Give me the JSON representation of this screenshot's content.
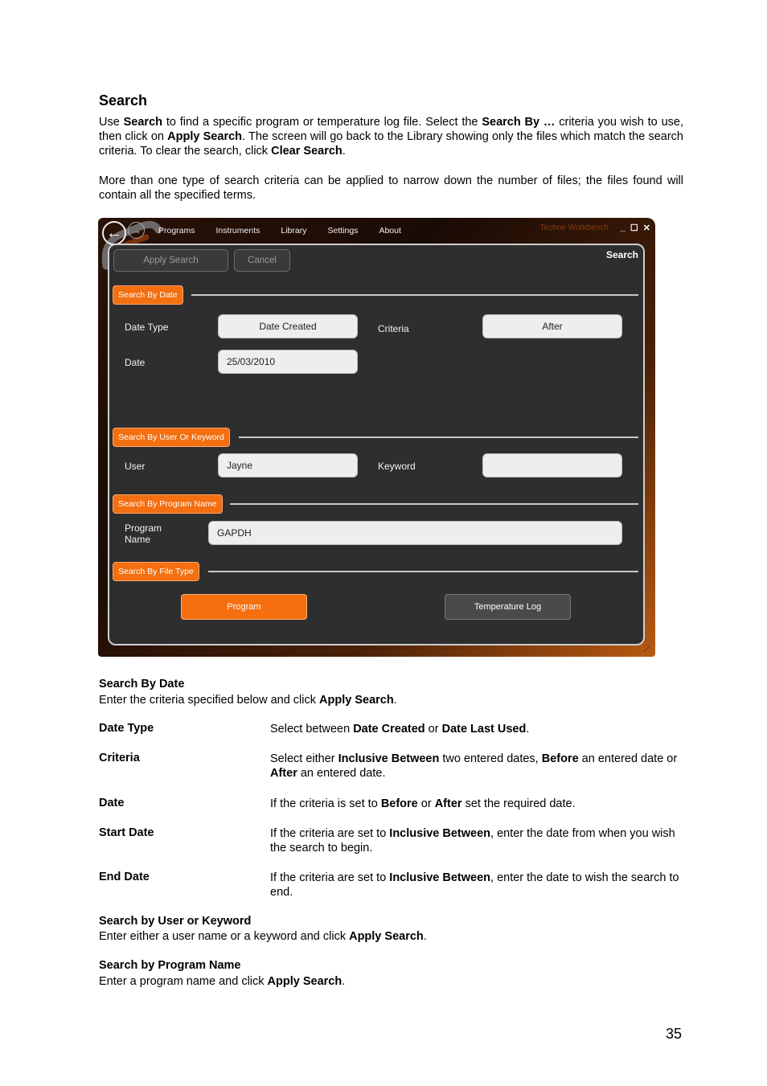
{
  "doc": {
    "title": "Search",
    "intro_parts": [
      {
        "t": "Use ",
        "b": false
      },
      {
        "t": "Search",
        "b": true
      },
      {
        "t": " to find a specific program or temperature log file. Select the ",
        "b": false
      },
      {
        "t": "Search By …",
        "b": true
      },
      {
        "t": " criteria you wish to use, then click on ",
        "b": false
      },
      {
        "t": "Apply Search",
        "b": true
      },
      {
        "t": ". The screen will go back to the Library showing only the files which match the search criteria. To clear the search, click ",
        "b": false
      },
      {
        "t": "Clear Search",
        "b": true
      },
      {
        "t": ".",
        "b": false
      }
    ],
    "para2": "More than one type of search criteria can be applied to narrow down the number of files; the files found will contain all the specified terms.",
    "page_number": "35"
  },
  "app": {
    "menu": [
      "Programs",
      "Instruments",
      "Library",
      "Settings",
      "About"
    ],
    "app_name": "Techne Workbench",
    "window_controls": {
      "minimize": "_",
      "maximize": "☐",
      "close": "✕"
    },
    "apply_search": "Apply Search",
    "cancel": "Cancel",
    "panel_title": "Search",
    "sections": {
      "date": "Search By Date",
      "user": "Search By User Or Keyword",
      "program": "Search By Program Name",
      "filetype": "Search By File Type"
    },
    "labels": {
      "date_type": "Date Type",
      "criteria": "Criteria",
      "date": "Date",
      "user": "User",
      "keyword": "Keyword",
      "program_name_1": "Program",
      "program_name_2": "Name"
    },
    "values": {
      "date_type": "Date Created",
      "criteria": "After",
      "date": "25/03/2010",
      "user": "Jayne",
      "keyword": "",
      "program_name": "GAPDH"
    },
    "file_types": {
      "program": "Program",
      "temperature_log": "Temperature Log",
      "selected": "Program"
    },
    "accent": "#f36f10"
  },
  "desc": {
    "date_head": "Search By Date",
    "date_intro": [
      {
        "t": "Enter the criteria specified below and click ",
        "b": false
      },
      {
        "t": "Apply Search",
        "b": true
      },
      {
        "t": ".",
        "b": false
      }
    ],
    "rows": [
      {
        "label": "Date Type",
        "parts": [
          {
            "t": "Select between ",
            "b": false
          },
          {
            "t": "Date Created",
            "b": true
          },
          {
            "t": " or ",
            "b": false
          },
          {
            "t": "Date Last Used",
            "b": true
          },
          {
            "t": ".",
            "b": false
          }
        ]
      },
      {
        "label": "Criteria",
        "parts": [
          {
            "t": "Select either ",
            "b": false
          },
          {
            "t": "Inclusive Between",
            "b": true
          },
          {
            "t": " two entered dates, ",
            "b": false
          },
          {
            "t": "Before",
            "b": true
          },
          {
            "t": " an entered date or ",
            "b": false
          },
          {
            "t": "After",
            "b": true
          },
          {
            "t": " an entered date.",
            "b": false
          }
        ]
      },
      {
        "label": "Date",
        "parts": [
          {
            "t": "If the criteria is set to ",
            "b": false
          },
          {
            "t": "Before",
            "b": true
          },
          {
            "t": " or ",
            "b": false
          },
          {
            "t": "After",
            "b": true
          },
          {
            "t": " set the required date.",
            "b": false
          }
        ]
      },
      {
        "label": "Start Date",
        "parts": [
          {
            "t": "If the criteria are set to ",
            "b": false
          },
          {
            "t": "Inclusive Between",
            "b": true
          },
          {
            "t": ", enter the date from when you wish the search to begin.",
            "b": false
          }
        ]
      },
      {
        "label": "End Date",
        "parts": [
          {
            "t": "If the criteria are set to ",
            "b": false
          },
          {
            "t": "Inclusive Between",
            "b": true
          },
          {
            "t": ", enter the date to wish the search to end.",
            "b": false
          }
        ]
      }
    ],
    "user_head": "Search by User or Keyword",
    "user_intro": [
      {
        "t": "Enter either a user name or a keyword and click ",
        "b": false
      },
      {
        "t": "Apply Search",
        "b": true
      },
      {
        "t": ".",
        "b": false
      }
    ],
    "program_head": "Search by Program Name",
    "program_intro": [
      {
        "t": "Enter a program name and click ",
        "b": false
      },
      {
        "t": "Apply Search",
        "b": true
      },
      {
        "t": ".",
        "b": false
      }
    ]
  }
}
